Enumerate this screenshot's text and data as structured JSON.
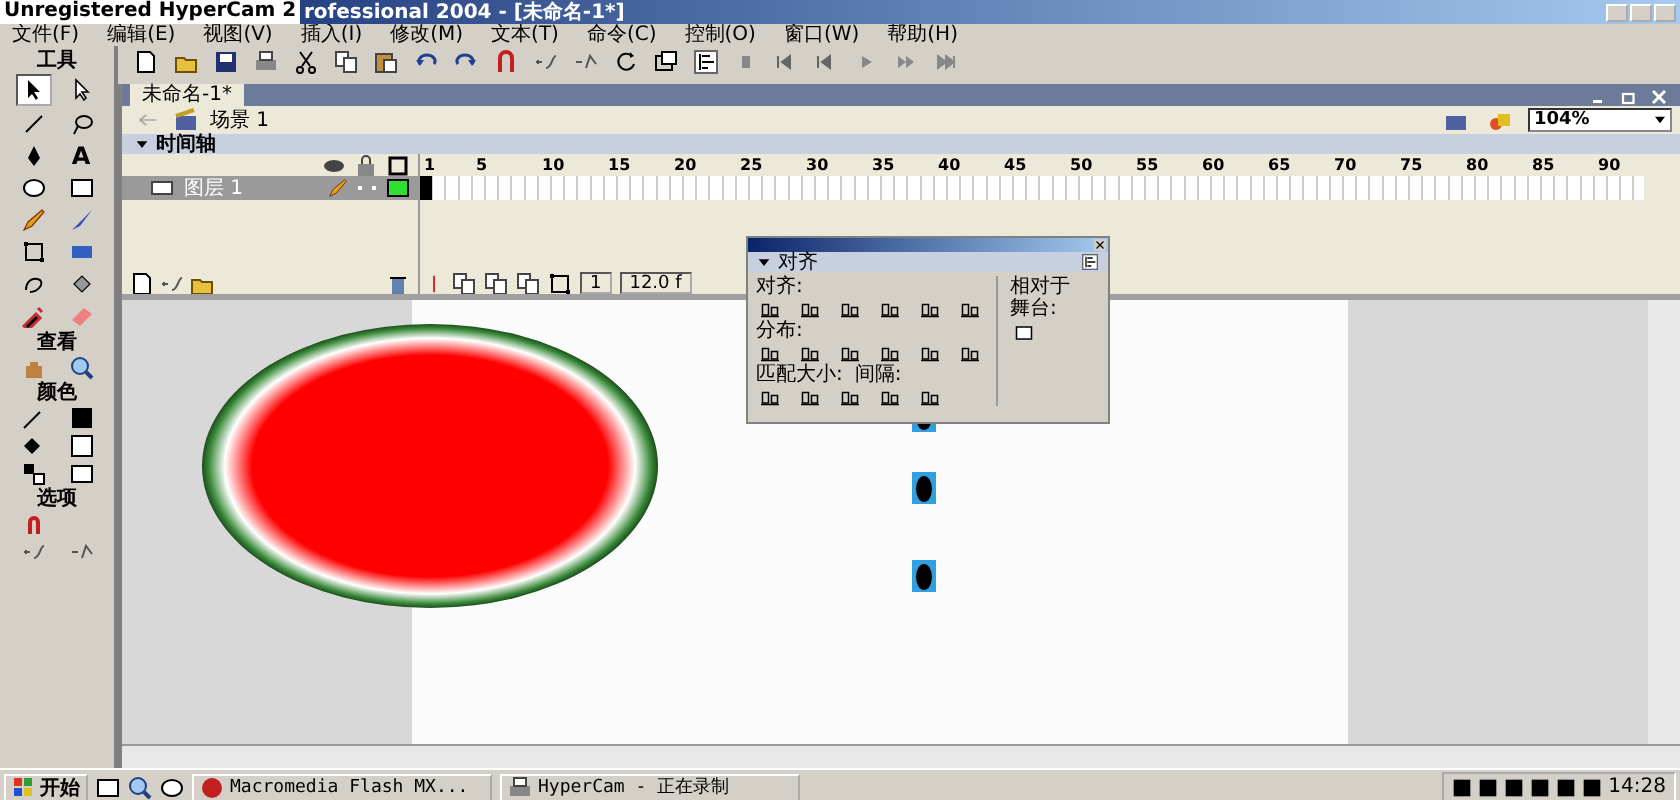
{
  "watermark": "Unregistered HyperCam 2",
  "window": {
    "title": "rofessional 2004 - [未命名-1*]"
  },
  "menu": [
    "文件(F)",
    "编辑(E)",
    "视图(V)",
    "插入(I)",
    "修改(M)",
    "文本(T)",
    "命令(C)",
    "控制(O)",
    "窗口(W)",
    "帮助(H)"
  ],
  "tools": {
    "title": "工具",
    "text_tool": "A",
    "view_title": "查看",
    "colors_title": "颜色",
    "options_title": "选项"
  },
  "document_tab": {
    "label": "未命名-1*",
    "selected": true
  },
  "scene": "场景 1",
  "zoom": "104%",
  "timeline": {
    "title": "时间轴",
    "ruler": [
      "1",
      "5",
      "10",
      "15",
      "20",
      "25",
      "30",
      "35",
      "40",
      "45",
      "50",
      "55",
      "60",
      "65",
      "70",
      "75",
      "80",
      "85",
      "90"
    ],
    "layers": [
      {
        "name": "图层 1",
        "selected": true
      }
    ],
    "current_frame": "1",
    "frame_rate": "12.0 f"
  },
  "align_panel": {
    "title": "对齐",
    "align_label": "对齐:",
    "distribute_label": "分布:",
    "match_size_label": "匹配大小:",
    "spacing_label": "间隔:",
    "to_stage_label": "相对于舞台:"
  },
  "taskbar": {
    "start": "开始",
    "tasks": [
      {
        "label": "Macromedia Flash MX...",
        "selected": false
      },
      {
        "label": "HyperCam - 正在录制",
        "selected": false
      }
    ],
    "clock": "14:28"
  }
}
